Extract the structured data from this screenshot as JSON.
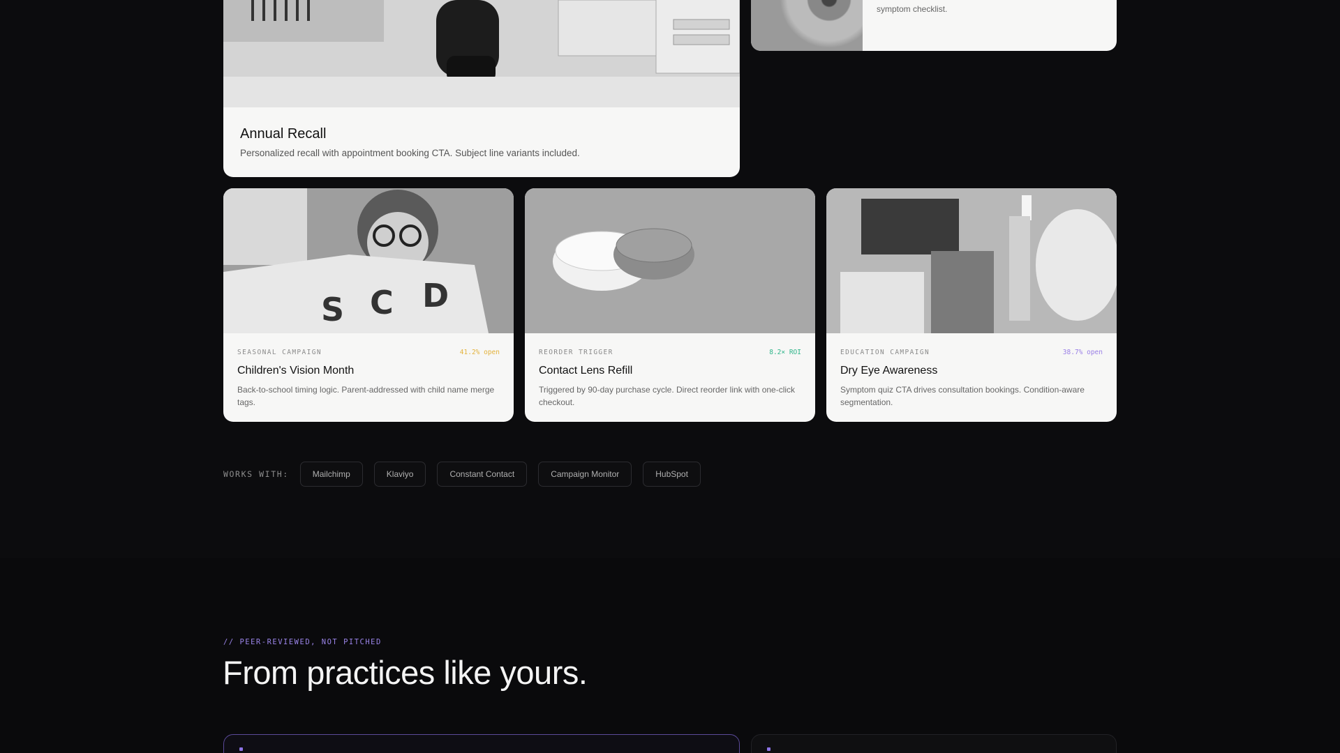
{
  "cards_top": {
    "recall": {
      "title": "Annual Recall",
      "description": "Personalized recall with appointment booking CTA. Subject line variants included."
    },
    "eye": {
      "description": "symptom checklist."
    }
  },
  "cards_bottom": [
    {
      "category": "SEASONAL CAMPAIGN",
      "metric": "41.2% open",
      "metric_color": "#e3b23c",
      "title": "Children's Vision Month",
      "description": "Back-to-school timing logic. Parent-addressed with child name merge tags."
    },
    {
      "category": "REORDER TRIGGER",
      "metric": "8.2× ROI",
      "metric_color": "#2fb58a",
      "title": "Contact Lens Refill",
      "description": "Triggered by 90-day purchase cycle. Direct reorder link with one-click checkout."
    },
    {
      "category": "EDUCATION CAMPAIGN",
      "metric": "38.7% open",
      "metric_color": "#9a7fe6",
      "title": "Dry Eye Awareness",
      "description": "Symptom quiz CTA drives consultation bookings. Condition-aware segmentation."
    }
  ],
  "integrations": {
    "label": "WORKS WITH:",
    "items": [
      "Mailchimp",
      "Klaviyo",
      "Constant Contact",
      "Campaign Monitor",
      "HubSpot"
    ]
  },
  "testimonials": {
    "kicker": "// PEER-REVIEWED, NOT PITCHED",
    "headline": "From practices like yours."
  },
  "colors": {
    "background": "#0c0c0e",
    "card": "#f7f7f6",
    "accent": "#9b85ea"
  }
}
